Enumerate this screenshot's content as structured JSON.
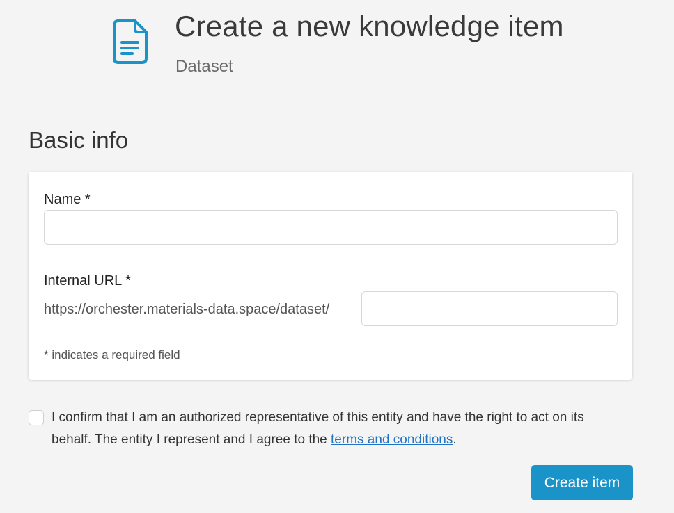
{
  "header": {
    "icon": "document-icon",
    "title": "Create a new knowledge item",
    "subtitle": "Dataset",
    "accent_color": "#1a93c9"
  },
  "basic_info": {
    "section_title": "Basic info",
    "name_field": {
      "label": "Name *",
      "value": "",
      "placeholder": ""
    },
    "url_field": {
      "label": "Internal URL *",
      "prefix": "https://orchester.materials-data.space/dataset/",
      "value": "",
      "placeholder": ""
    },
    "required_note": "* indicates a required field"
  },
  "confirm": {
    "checked": false,
    "text_before": "I confirm that I am an authorized representative of this entity and have the right to act on its behalf. The entity I represent and I agree to the ",
    "link_text": "terms and conditions",
    "text_after": ".",
    "link_color": "#1f72c4"
  },
  "actions": {
    "create_label": "Create item",
    "button_color": "#1a93c9"
  }
}
